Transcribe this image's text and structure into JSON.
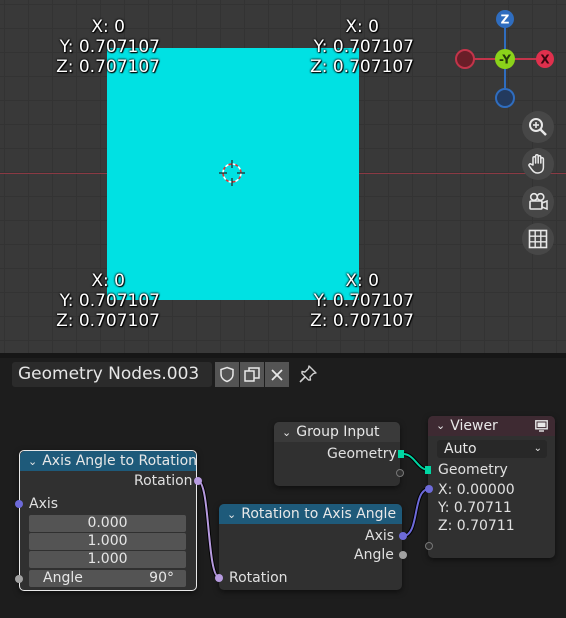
{
  "viewport": {
    "corner_labels": [
      {
        "x": "X: 0",
        "y": "Y: 0.707107",
        "z": "Z: 0.707107"
      },
      {
        "x": "X: 0",
        "y": "Y: 0.707107",
        "z": "Z: 0.707107"
      },
      {
        "x": "X: 0",
        "y": "Y: 0.707107",
        "z": "Z: 0.707107"
      },
      {
        "x": "X: 0",
        "y": "Y: 0.707107",
        "z": "Z: 0.707107"
      }
    ],
    "gizmo": {
      "z": "Z",
      "neg_y": "-Y",
      "x": "X"
    },
    "plane_color": "#00e1e3",
    "nav_icons": [
      "zoom-icon",
      "hand-pan-icon",
      "camera-icon",
      "grid-icon"
    ]
  },
  "editor": {
    "tree_name": "Geometry Nodes.003"
  },
  "nodes": {
    "axis_angle": {
      "title": "Axis Angle to Rotation",
      "out_rotation": "Rotation",
      "in_axis": "Axis",
      "axis_values": [
        "0.000",
        "1.000",
        "1.000"
      ],
      "angle_label": "Angle",
      "angle_value": "90°"
    },
    "group_input": {
      "title": "Group Input",
      "out_geometry": "Geometry"
    },
    "rot_to_axis": {
      "title": "Rotation to Axis Angle",
      "out_axis": "Axis",
      "out_angle": "Angle",
      "in_rotation": "Rotation"
    },
    "viewer": {
      "title": "Viewer",
      "mode": "Auto",
      "in_geometry": "Geometry",
      "values": [
        "X: 0.00000",
        "Y: 0.70711",
        "Z: 0.70711"
      ]
    }
  }
}
